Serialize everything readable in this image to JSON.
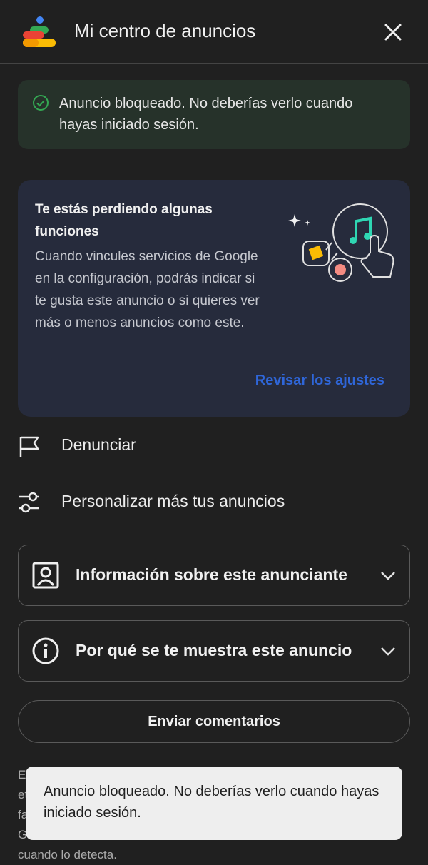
{
  "header": {
    "title": "Mi centro de anuncios",
    "close_icon": "close-icon"
  },
  "alert": {
    "text": "Anuncio bloqueado. No deberías verlo cuando hayas iniciado sesión.",
    "icon": "check-circle-icon",
    "accent": "#34a853"
  },
  "promo": {
    "heading": "Te estás perdiendo algunas funciones",
    "body": "Cuando vincules servicios de Google en la configuración, podrás indicar si te gusta este anuncio o si quieres ver más o menos anuncios como este.",
    "link": "Revisar los ajustes",
    "link_color": "#2f66d8"
  },
  "actions": {
    "report": {
      "label": "Denunciar",
      "icon": "flag-icon"
    },
    "customize": {
      "label": "Personalizar más tus anuncios",
      "icon": "sliders-icon"
    }
  },
  "accordions": {
    "advertiser": {
      "label": "Información sobre este anunciante",
      "icon": "person-badge-icon"
    },
    "why": {
      "label": "Por qué se te muestra este anuncio",
      "icon": "info-icon"
    }
  },
  "feedback": {
    "label": "Enviar comentarios"
  },
  "background_text": "Es\net\nfa\nG\ncuando lo detecta.",
  "toast": {
    "text": "Anuncio bloqueado. No deberías verlo cuando hayas iniciado sesión."
  }
}
